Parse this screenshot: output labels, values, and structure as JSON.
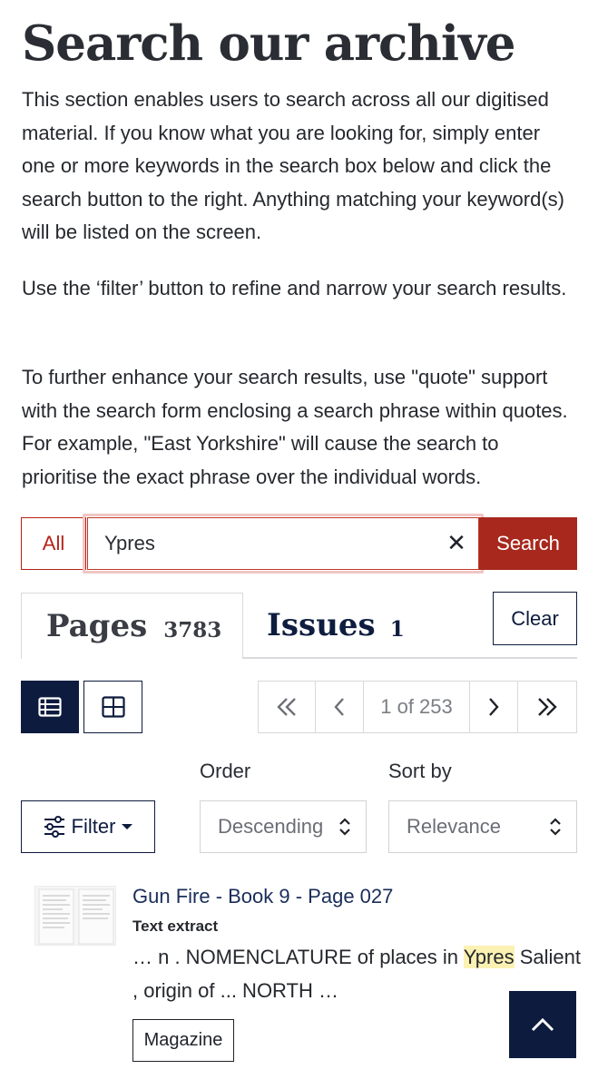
{
  "page": {
    "title": "Search our archive",
    "paragraphs": [
      "This section enables users to search across all our digitised material. If you know what you are looking for, simply enter one or more keywords in the search box below and click the search button to the right. Anything matching your keyword(s) will be listed on the screen.",
      "Use the ‘filter’ button to refine and narrow your search results.",
      "To further enhance your search results, use \"quote\" support with the search form enclosing a search phrase within quotes. For example, \"East Yorkshire\" will cause the search to prioritise the exact phrase over the individual words."
    ]
  },
  "search": {
    "scope_label": "All",
    "query": "Ypres",
    "clear_glyph": "✕",
    "button_label": "Search"
  },
  "tabs": [
    {
      "label": "Pages",
      "count": "3783",
      "active": true
    },
    {
      "label": "Issues",
      "count": "1",
      "active": false
    }
  ],
  "clear_label": "Clear",
  "pagination": {
    "first_glyph": "«",
    "prev_glyph": "‹",
    "info": "1 of 253",
    "next_glyph": "›",
    "last_glyph": "»"
  },
  "controls": {
    "order_label": "Order",
    "order_value": "Descending",
    "sort_label": "Sort by",
    "sort_value": "Relevance",
    "filter_label": "Filter"
  },
  "result": {
    "title": "Gun Fire - Book 9 - Page 027",
    "subtitle": "Text extract",
    "text_before": "… n . NOMENCLATURE of places in ",
    "highlight": "Ypres",
    "text_after": " Salient , origin of ... NORTH …",
    "badge": "Magazine"
  },
  "colors": {
    "accent_red": "#a8281d",
    "navy": "#0d1b3e",
    "highlight": "#fbf1b2"
  }
}
